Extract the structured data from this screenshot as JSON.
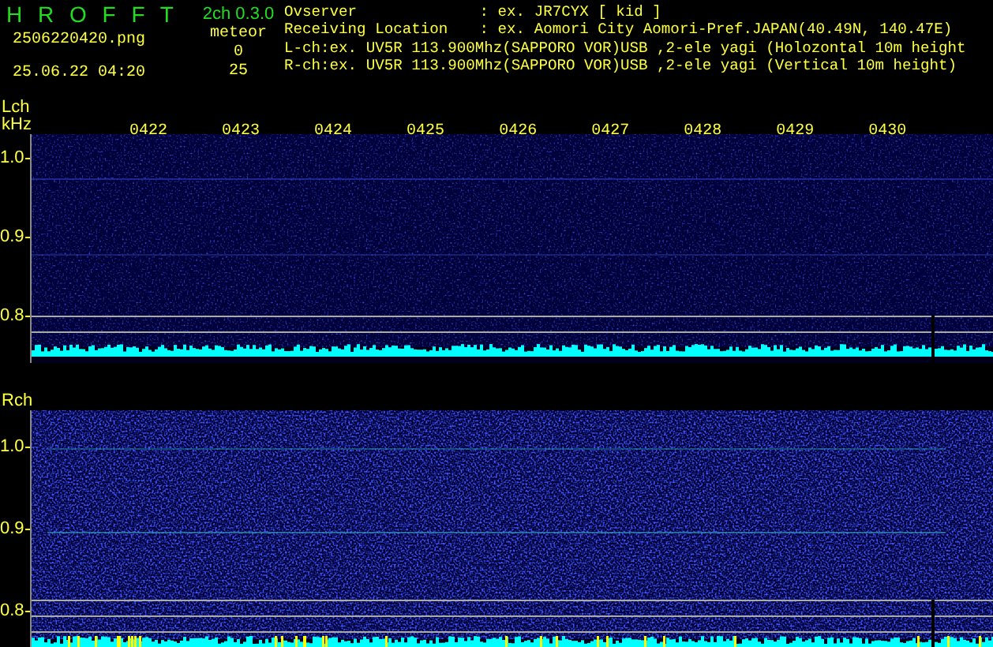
{
  "app": {
    "title": "H R O F F T",
    "version": "2ch 0.3.0",
    "filename": "2506220420.png",
    "datetime": "25.06.22 04:20"
  },
  "meteor": {
    "label": "meteor",
    "counts": [
      "0",
      "25"
    ]
  },
  "info": [
    {
      "label": "Ovserver",
      "value": ": ex. JR7CYX [ kid ]"
    },
    {
      "label": "Receiving Location",
      "value": ": ex. Aomori City Aomori-Pref.JAPAN(40.49N, 140.47E)"
    },
    {
      "label": "L-ch:ex. UV5R 113.900Mhz(SAPPORO VOR)USB ,2-ele yagi (Holozontal 10m height"
    },
    {
      "label": "R-ch:ex. UV5R 113.900Mhz(SAPPORO VOR)USB ,2-ele yagi (Vertical 10m height)"
    }
  ],
  "channels": [
    {
      "label": "Lch",
      "unit": "kHz",
      "yticks": [
        "1.0",
        "0.9",
        "0.8"
      ],
      "time_labels": [
        "0422",
        "0423",
        "0424",
        "0425",
        "0426",
        "0427",
        "0428",
        "0429",
        "0430"
      ]
    },
    {
      "label": "Rch",
      "yticks": [
        "1.0",
        "0.9",
        "0.8"
      ]
    }
  ]
}
